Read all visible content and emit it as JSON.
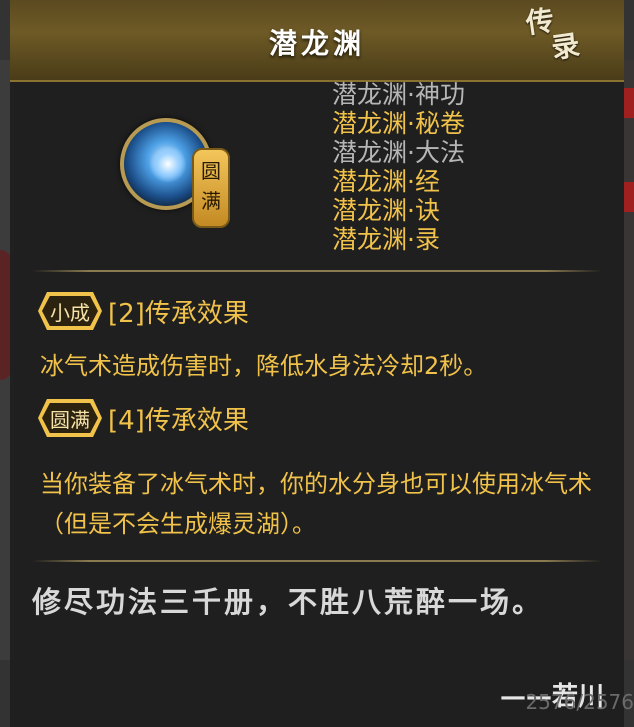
{
  "panel": {
    "title": "潜龙渊",
    "corner_tag_line1": "传",
    "corner_tag_line2": "录"
  },
  "skill_icon": {
    "badge_line1": "圆",
    "badge_line2": "满"
  },
  "related_names": [
    {
      "text": "潜龙渊·神功",
      "color": "gray"
    },
    {
      "text": "潜龙渊·秘卷",
      "color": "gold"
    },
    {
      "text": "潜龙渊·大法",
      "color": "gray"
    },
    {
      "text": "潜龙渊·经",
      "color": "gold"
    },
    {
      "text": "潜龙渊·诀",
      "color": "gold"
    },
    {
      "text": "潜龙渊·录",
      "color": "gold"
    }
  ],
  "effects": [
    {
      "badge": "小成",
      "title": "[2]传承效果",
      "text": "冰气术造成伤害时，降低水身法冷却2秒。"
    },
    {
      "badge": "圆满",
      "title": "[4]传承效果",
      "text": "当你装备了冰气术时，你的水分身也可以使用冰气术（但是不会生成爆灵湖）。"
    }
  ],
  "poem": "修尽功法三千册，不胜八荒醉一场。",
  "signature": "——若川",
  "background_text": "2576/2576",
  "colors": {
    "gold": "#f1c24a",
    "gray": "#b6b6b6",
    "header": "#6e5a26"
  }
}
